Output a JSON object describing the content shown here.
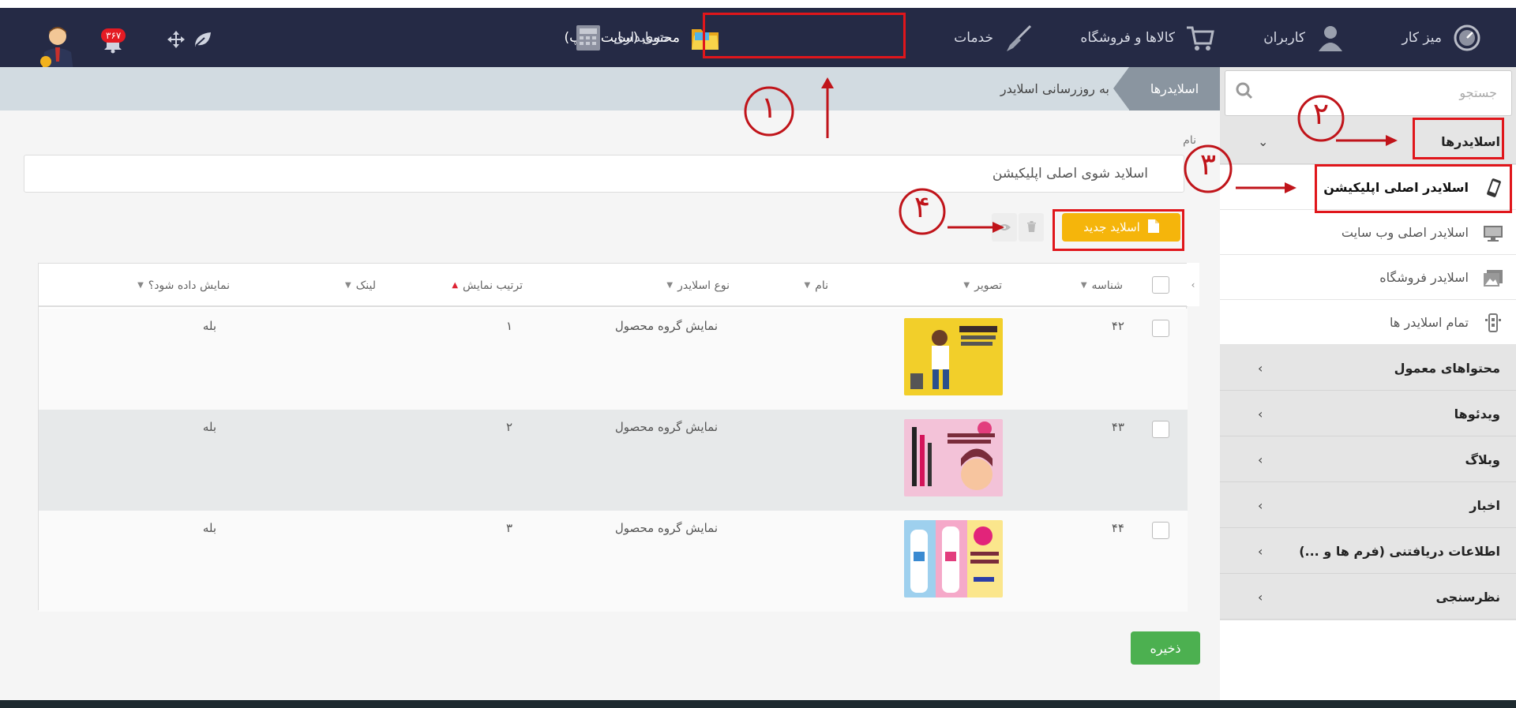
{
  "nav": {
    "items": [
      {
        "label": "میز کار",
        "icon": "dashboard-gauge-icon"
      },
      {
        "label": "کاربران",
        "icon": "user-icon"
      },
      {
        "label": "کالاها و فروشگاه",
        "icon": "shopping-cart-icon"
      },
      {
        "label": "خدمات",
        "icon": "broom-icon"
      },
      {
        "label": "محتوی (سایت و اپ)",
        "icon": "folder-icon"
      },
      {
        "label": "حسابداری",
        "icon": "calculator-icon"
      }
    ],
    "notification_count": "۳۶۷"
  },
  "breadcrumb": {
    "active": "اسلایدرها",
    "current": "به روزرسانی اسلایدر"
  },
  "form": {
    "name_label": "نام",
    "name_value": "اسلاید شوی اصلی اپلیکیشن"
  },
  "toolbar": {
    "new_slide_label": "اسلاید جدید",
    "save_label": "ذخیره"
  },
  "table": {
    "headers": {
      "id": "شناسه",
      "image": "تصویر",
      "name": "نام",
      "type": "نوع اسلایدر",
      "order": "ترتیب نمایش",
      "link": "لینک",
      "visible": "نمایش داده شود؟"
    },
    "rows": [
      {
        "id": "۴۲",
        "type": "نمایش گروه محصول",
        "order": "۱",
        "visible": "بله",
        "thumb_color": "#f2cf2a"
      },
      {
        "id": "۴۳",
        "type": "نمایش گروه محصول",
        "order": "۲",
        "visible": "بله",
        "thumb_color": "#f3c2d8"
      },
      {
        "id": "۴۴",
        "type": "نمایش گروه محصول",
        "order": "۳",
        "visible": "بله",
        "thumb_color": "#fbe68c"
      }
    ]
  },
  "sidebar": {
    "search_placeholder": "جستجو",
    "groups": [
      {
        "label": "اسلایدرها",
        "expanded": true
      },
      {
        "label": "محتواهای معمول"
      },
      {
        "label": "ویدئوها"
      },
      {
        "label": "وبلاگ"
      },
      {
        "label": "اخبار"
      },
      {
        "label": "اطلاعات دریافتنی (فرم ها و ...)"
      },
      {
        "label": "نظرسنجی"
      }
    ],
    "sub_items": [
      {
        "label": "اسلایدر اصلی اپلیکیشن",
        "icon": "mobile-icon",
        "active": true
      },
      {
        "label": "اسلایدر اصلی وب سایت",
        "icon": "monitor-icon"
      },
      {
        "label": "اسلایدر فروشگاه",
        "icon": "image-icon"
      },
      {
        "label": "تمام اسلایدر ها",
        "icon": "gallery-icon"
      }
    ]
  },
  "annotations": {
    "n1": "١",
    "n2": "٢",
    "n3": "٣",
    "n4": "۴"
  },
  "colors": {
    "navbar": "#252a45",
    "highlight": "#e0161b",
    "new_button": "#f5b50b",
    "save_button": "#4cb050"
  }
}
